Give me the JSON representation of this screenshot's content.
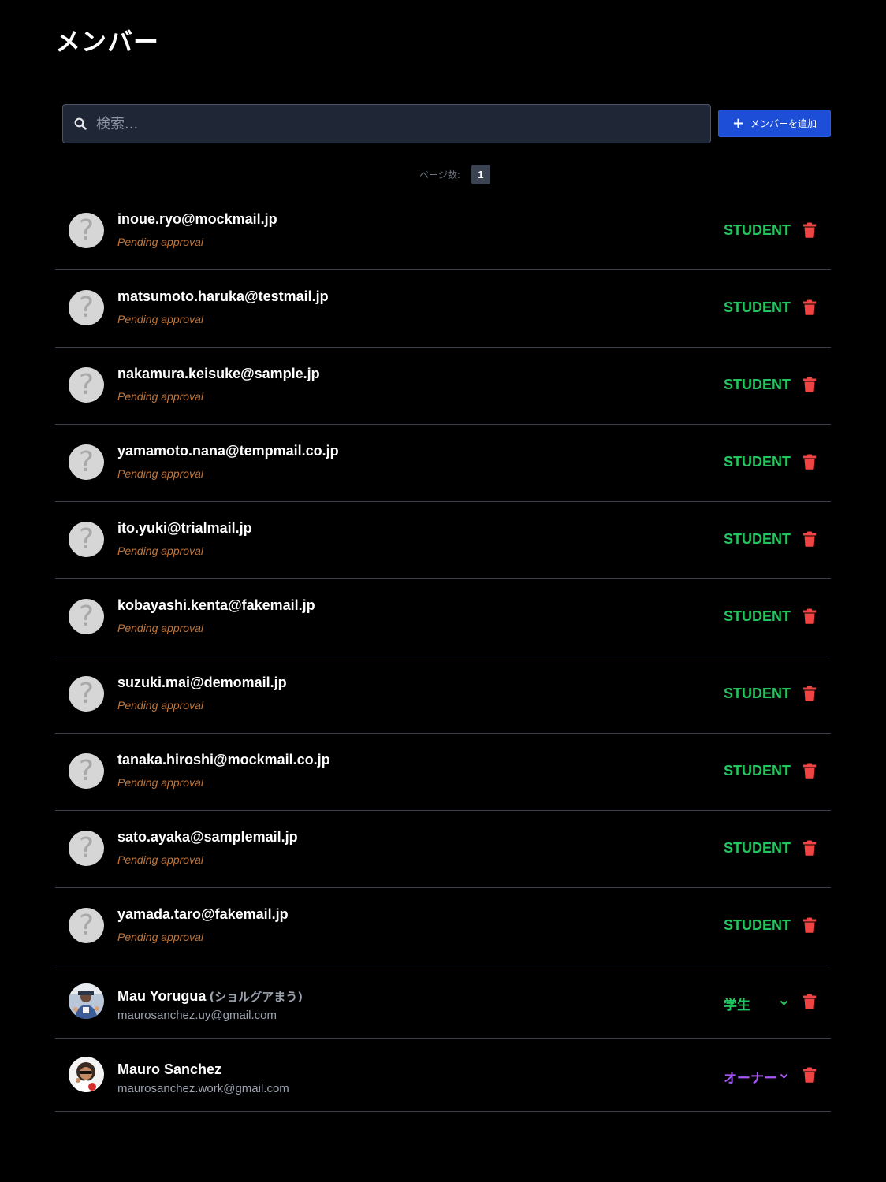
{
  "page": {
    "title": "メンバー"
  },
  "toolbar": {
    "search_placeholder": "検索...",
    "add_button_label": "メンバーを追加"
  },
  "pagination": {
    "label": "ページ数:",
    "current_page": "1"
  },
  "pending_members": [
    {
      "email": "inoue.ryo@mockmail.jp",
      "status": "Pending approval",
      "role": "STUDENT"
    },
    {
      "email": "matsumoto.haruka@testmail.jp",
      "status": "Pending approval",
      "role": "STUDENT"
    },
    {
      "email": "nakamura.keisuke@sample.jp",
      "status": "Pending approval",
      "role": "STUDENT"
    },
    {
      "email": "yamamoto.nana@tempmail.co.jp",
      "status": "Pending approval",
      "role": "STUDENT"
    },
    {
      "email": "ito.yuki@trialmail.jp",
      "status": "Pending approval",
      "role": "STUDENT"
    },
    {
      "email": "kobayashi.kenta@fakemail.jp",
      "status": "Pending approval",
      "role": "STUDENT"
    },
    {
      "email": "suzuki.mai@demomail.jp",
      "status": "Pending approval",
      "role": "STUDENT"
    },
    {
      "email": "tanaka.hiroshi@mockmail.co.jp",
      "status": "Pending approval",
      "role": "STUDENT"
    },
    {
      "email": "sato.ayaka@samplemail.jp",
      "status": "Pending approval",
      "role": "STUDENT"
    },
    {
      "email": "yamada.taro@fakemail.jp",
      "status": "Pending approval",
      "role": "STUDENT"
    }
  ],
  "active_members": [
    {
      "name": "Mau Yorugua",
      "kana": "(ショルグアまう)",
      "email": "maurosanchez.uy@gmail.com",
      "role": "学生"
    },
    {
      "name": "Mauro Sanchez",
      "kana": "",
      "email": "maurosanchez.work@gmail.com",
      "role": "オーナー"
    }
  ],
  "colors": {
    "background": "#000000",
    "search_background": "#1f2736",
    "add_button": "#1d4ed8",
    "student_role": "#22c55e",
    "owner_role": "#a855f7",
    "pending_status": "#c2763a",
    "delete_icon": "#ef4444",
    "divider": "#3a3f4a"
  },
  "icons": {
    "search": "search-icon",
    "add": "plus-icon",
    "delete": "trash-icon",
    "dropdown": "chevron-down-icon",
    "unknown_avatar": "question-mark-avatar"
  }
}
